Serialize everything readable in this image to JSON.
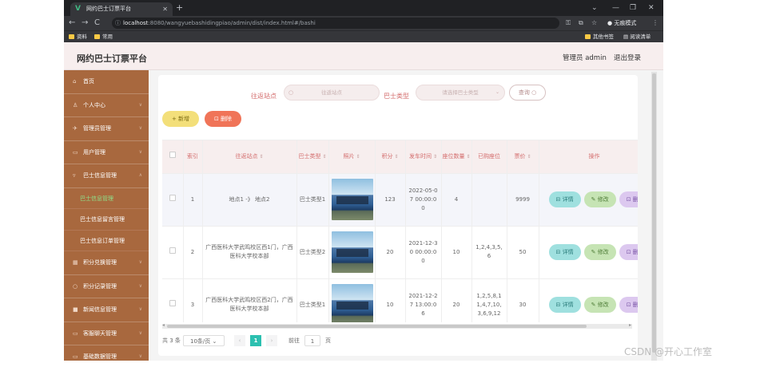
{
  "browser": {
    "tab_title": "网约巴士订票平台",
    "tab_logo": "V",
    "url_host": "localhost",
    "url_path": ":8080/wangyuebashidingpiao/admin/dist/index.html#/bashi",
    "incognito_label": "无痕模式",
    "bookmarks": {
      "left1": "资料",
      "left2": "常用",
      "right1": "其他书签",
      "right2": "阅读清单"
    }
  },
  "header": {
    "title": "网约巴士订票平台",
    "admin_info": "管理员 admin",
    "logout": "退出登录"
  },
  "sidebar": {
    "items": [
      {
        "label": "首页"
      },
      {
        "label": "个人中心"
      },
      {
        "label": "管理员管理"
      },
      {
        "label": "用户管理"
      },
      {
        "label": "巴士信息管理"
      }
    ],
    "subitems": [
      {
        "label": "巴士信息管理",
        "active": true
      },
      {
        "label": "巴士信息留言管理"
      },
      {
        "label": "巴士信息订单管理"
      }
    ],
    "items2": [
      {
        "label": "积分兑换管理"
      },
      {
        "label": "积分记录管理"
      },
      {
        "label": "新闻信息管理"
      },
      {
        "label": "客服聊天管理"
      },
      {
        "label": "基础数据管理"
      }
    ]
  },
  "search": {
    "route_label": "往返站点",
    "route_placeholder": "往返站点",
    "type_label": "巴士类型",
    "type_placeholder": "请选择巴士类型",
    "button": "查询"
  },
  "actions": {
    "add": "+ 新增",
    "delete": "删除"
  },
  "table": {
    "headers": [
      "",
      "索引",
      "往返站点",
      "巴士类型",
      "照片",
      "积分",
      "发车时间",
      "座位数量",
      "已购座位",
      "票价",
      "操作"
    ],
    "sortable": [
      false,
      false,
      true,
      true,
      true,
      true,
      true,
      true,
      false,
      true,
      false
    ],
    "rows": [
      {
        "index": "1",
        "route": "地点1 -》 地点2",
        "type": "巴士类型1",
        "points": "123",
        "time": "2022-05-07 00:00:00",
        "seats": "4",
        "bought": "",
        "price": "9999"
      },
      {
        "index": "2",
        "route": "广西医科大学武鸣校区西1门，广西医科大学校本部",
        "type": "巴士类型2",
        "points": "20",
        "time": "2021-12-30 00:00:00",
        "seats": "10",
        "bought": "1,2,4,3,5,6",
        "price": "50"
      },
      {
        "index": "3",
        "route": "广西医科大学武鸣校区西2门，广西医科大学校本部",
        "type": "巴士类型1",
        "points": "10",
        "time": "2021-12-27 13:00:06",
        "seats": "20",
        "bought": "1,2,5,8,11,4,7,10,3,6,9,12",
        "price": "30"
      }
    ],
    "op_detail": "详情",
    "op_edit": "修改",
    "op_delete": "删除"
  },
  "pager": {
    "total": "共 3 条",
    "page_size": "10条/页",
    "current": "1",
    "goto_label": "前往",
    "goto_value": "1",
    "page_suffix": "页"
  },
  "watermark": "CSDN @开心工作室",
  "colors": {
    "sidebar": "#a8683e",
    "header": "#f7eeee",
    "accent": "#d36b6b",
    "page_active": "#2cc0b0"
  }
}
